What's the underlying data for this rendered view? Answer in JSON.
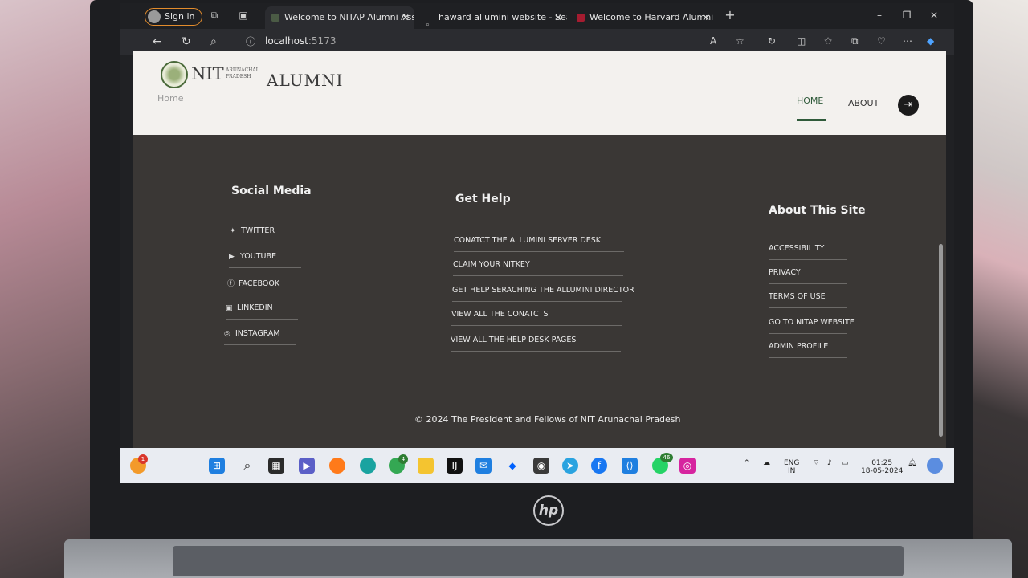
{
  "browser": {
    "signin_label": "Sign in",
    "tabs": [
      {
        "title": "Welcome to NITAP Alumni Assoc",
        "active": true
      },
      {
        "title": "haward allumini website - Search",
        "active": false
      },
      {
        "title": "Welcome to Harvard Alumni",
        "active": false
      }
    ],
    "url_host": "localhost",
    "url_port": ":5173"
  },
  "site": {
    "logo_nit": "NIT",
    "logo_sub_line1": "ARUNACHAL",
    "logo_sub_line2": "PRADESH",
    "logo_alumni": "ALUMNI",
    "breadcrumb": "Home",
    "nav": {
      "home": "HOME",
      "about": "ABOUT"
    }
  },
  "footer": {
    "social": {
      "title": "Social Media",
      "links": [
        {
          "label": "TWITTER",
          "icon": "twitter-icon"
        },
        {
          "label": "YOUTUBE",
          "icon": "youtube-icon"
        },
        {
          "label": "FACEBOOK",
          "icon": "facebook-icon"
        },
        {
          "label": "LINKEDIN",
          "icon": "linkedin-icon"
        },
        {
          "label": "INSTAGRAM",
          "icon": "instagram-icon"
        }
      ]
    },
    "help": {
      "title": "Get Help",
      "links": [
        "CONATCT THE ALLUMINI SERVER DESK",
        "CLAIM YOUR NITKEY",
        "GET HELP SERACHING THE ALLUMINI DIRECTOR",
        "VIEW ALL THE CONATCTS",
        "VIEW ALL THE HELP DESK PAGES"
      ]
    },
    "about": {
      "title": "About This Site",
      "links": [
        "ACCESSIBILITY",
        "PRIVACY",
        "TERMS OF USE",
        "GO TO NITAP WEBSITE",
        "ADMIN PROFILE"
      ]
    },
    "copyright": "© 2024 The President and Fellows of NIT Arunachal Pradesh"
  },
  "taskbar": {
    "notification_badge": "1",
    "chrome_badge": "4",
    "whatsapp_badge": "46",
    "lang_line1": "ENG",
    "lang_line2": "IN",
    "time": "01:25",
    "date": "18-05-2024"
  },
  "colors": {
    "accent_green": "#2f5a3a",
    "footer_bg": "#3a3735",
    "signin_border": "#e38c2c"
  }
}
